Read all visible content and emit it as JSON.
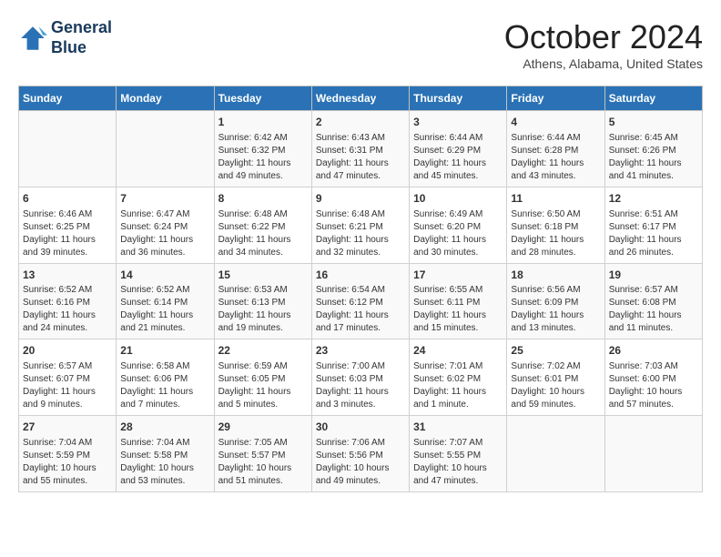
{
  "header": {
    "logo_line1": "General",
    "logo_line2": "Blue",
    "month_title": "October 2024",
    "subtitle": "Athens, Alabama, United States"
  },
  "days_of_week": [
    "Sunday",
    "Monday",
    "Tuesday",
    "Wednesday",
    "Thursday",
    "Friday",
    "Saturday"
  ],
  "weeks": [
    [
      {
        "day": "",
        "info": ""
      },
      {
        "day": "",
        "info": ""
      },
      {
        "day": "1",
        "info": "Sunrise: 6:42 AM\nSunset: 6:32 PM\nDaylight: 11 hours and 49 minutes."
      },
      {
        "day": "2",
        "info": "Sunrise: 6:43 AM\nSunset: 6:31 PM\nDaylight: 11 hours and 47 minutes."
      },
      {
        "day": "3",
        "info": "Sunrise: 6:44 AM\nSunset: 6:29 PM\nDaylight: 11 hours and 45 minutes."
      },
      {
        "day": "4",
        "info": "Sunrise: 6:44 AM\nSunset: 6:28 PM\nDaylight: 11 hours and 43 minutes."
      },
      {
        "day": "5",
        "info": "Sunrise: 6:45 AM\nSunset: 6:26 PM\nDaylight: 11 hours and 41 minutes."
      }
    ],
    [
      {
        "day": "6",
        "info": "Sunrise: 6:46 AM\nSunset: 6:25 PM\nDaylight: 11 hours and 39 minutes."
      },
      {
        "day": "7",
        "info": "Sunrise: 6:47 AM\nSunset: 6:24 PM\nDaylight: 11 hours and 36 minutes."
      },
      {
        "day": "8",
        "info": "Sunrise: 6:48 AM\nSunset: 6:22 PM\nDaylight: 11 hours and 34 minutes."
      },
      {
        "day": "9",
        "info": "Sunrise: 6:48 AM\nSunset: 6:21 PM\nDaylight: 11 hours and 32 minutes."
      },
      {
        "day": "10",
        "info": "Sunrise: 6:49 AM\nSunset: 6:20 PM\nDaylight: 11 hours and 30 minutes."
      },
      {
        "day": "11",
        "info": "Sunrise: 6:50 AM\nSunset: 6:18 PM\nDaylight: 11 hours and 28 minutes."
      },
      {
        "day": "12",
        "info": "Sunrise: 6:51 AM\nSunset: 6:17 PM\nDaylight: 11 hours and 26 minutes."
      }
    ],
    [
      {
        "day": "13",
        "info": "Sunrise: 6:52 AM\nSunset: 6:16 PM\nDaylight: 11 hours and 24 minutes."
      },
      {
        "day": "14",
        "info": "Sunrise: 6:52 AM\nSunset: 6:14 PM\nDaylight: 11 hours and 21 minutes."
      },
      {
        "day": "15",
        "info": "Sunrise: 6:53 AM\nSunset: 6:13 PM\nDaylight: 11 hours and 19 minutes."
      },
      {
        "day": "16",
        "info": "Sunrise: 6:54 AM\nSunset: 6:12 PM\nDaylight: 11 hours and 17 minutes."
      },
      {
        "day": "17",
        "info": "Sunrise: 6:55 AM\nSunset: 6:11 PM\nDaylight: 11 hours and 15 minutes."
      },
      {
        "day": "18",
        "info": "Sunrise: 6:56 AM\nSunset: 6:09 PM\nDaylight: 11 hours and 13 minutes."
      },
      {
        "day": "19",
        "info": "Sunrise: 6:57 AM\nSunset: 6:08 PM\nDaylight: 11 hours and 11 minutes."
      }
    ],
    [
      {
        "day": "20",
        "info": "Sunrise: 6:57 AM\nSunset: 6:07 PM\nDaylight: 11 hours and 9 minutes."
      },
      {
        "day": "21",
        "info": "Sunrise: 6:58 AM\nSunset: 6:06 PM\nDaylight: 11 hours and 7 minutes."
      },
      {
        "day": "22",
        "info": "Sunrise: 6:59 AM\nSunset: 6:05 PM\nDaylight: 11 hours and 5 minutes."
      },
      {
        "day": "23",
        "info": "Sunrise: 7:00 AM\nSunset: 6:03 PM\nDaylight: 11 hours and 3 minutes."
      },
      {
        "day": "24",
        "info": "Sunrise: 7:01 AM\nSunset: 6:02 PM\nDaylight: 11 hours and 1 minute."
      },
      {
        "day": "25",
        "info": "Sunrise: 7:02 AM\nSunset: 6:01 PM\nDaylight: 10 hours and 59 minutes."
      },
      {
        "day": "26",
        "info": "Sunrise: 7:03 AM\nSunset: 6:00 PM\nDaylight: 10 hours and 57 minutes."
      }
    ],
    [
      {
        "day": "27",
        "info": "Sunrise: 7:04 AM\nSunset: 5:59 PM\nDaylight: 10 hours and 55 minutes."
      },
      {
        "day": "28",
        "info": "Sunrise: 7:04 AM\nSunset: 5:58 PM\nDaylight: 10 hours and 53 minutes."
      },
      {
        "day": "29",
        "info": "Sunrise: 7:05 AM\nSunset: 5:57 PM\nDaylight: 10 hours and 51 minutes."
      },
      {
        "day": "30",
        "info": "Sunrise: 7:06 AM\nSunset: 5:56 PM\nDaylight: 10 hours and 49 minutes."
      },
      {
        "day": "31",
        "info": "Sunrise: 7:07 AM\nSunset: 5:55 PM\nDaylight: 10 hours and 47 minutes."
      },
      {
        "day": "",
        "info": ""
      },
      {
        "day": "",
        "info": ""
      }
    ]
  ]
}
